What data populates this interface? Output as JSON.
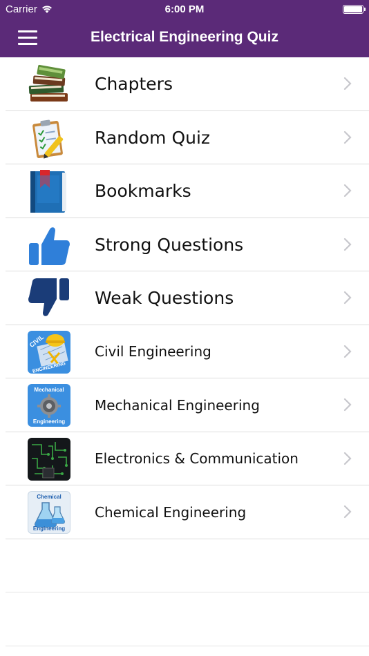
{
  "status": {
    "carrier": "Carrier",
    "time": "6:00 PM",
    "wifi_icon": "wifi-icon",
    "battery_icon": "battery-icon"
  },
  "navbar": {
    "title": "Electrical Engineering Quiz",
    "menu_icon": "hamburger-menu-icon",
    "color": "#5b2a78"
  },
  "menu": {
    "items": [
      {
        "label": "Chapters",
        "icon": "books-icon"
      },
      {
        "label": "Random Quiz",
        "icon": "clipboard-pencil-icon"
      },
      {
        "label": "Bookmarks",
        "icon": "bookmark-book-icon"
      },
      {
        "label": "Strong Questions",
        "icon": "thumbs-up-icon"
      },
      {
        "label": "Weak Questions",
        "icon": "thumbs-down-icon"
      },
      {
        "label": "Civil Engineering",
        "icon": "civil-engineering-icon",
        "icon_text": [
          "CIVIL",
          "ENGINEERING"
        ]
      },
      {
        "label": "Mechanical Engineering",
        "icon": "mechanical-engineering-icon",
        "icon_text": [
          "Mechanical",
          "Engineering"
        ]
      },
      {
        "label": "Electronics & Communication",
        "icon": "circuit-board-icon"
      },
      {
        "label": "Chemical Engineering",
        "icon": "chemical-engineering-icon",
        "icon_text": [
          "Chemical",
          "Engineering"
        ]
      }
    ]
  },
  "colors": {
    "brand": "#5b2a78",
    "thumb_blue": "#2f7fd9",
    "separator": "#dcdcdc",
    "chevron": "#c7c7cc"
  }
}
